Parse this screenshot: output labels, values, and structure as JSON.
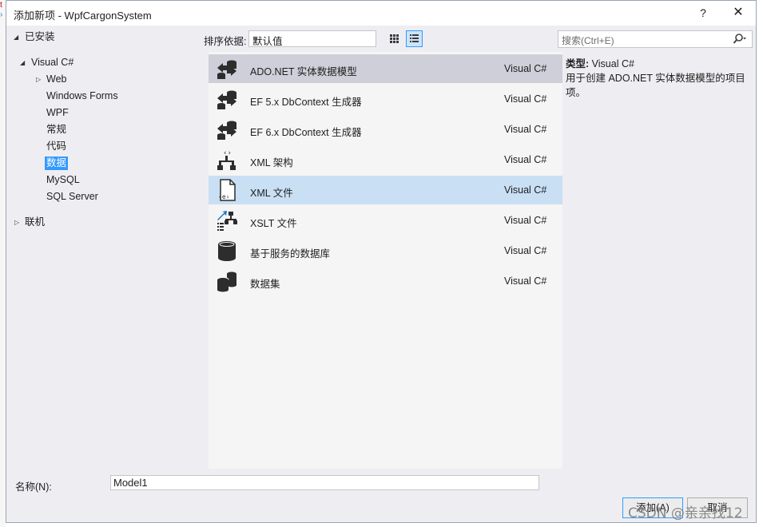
{
  "window": {
    "title": "添加新项 - WpfCargonSystem",
    "help_glyph": "?",
    "close_glyph": "✕"
  },
  "tree": {
    "installed": "已安装",
    "visual_csharp": "Visual C#",
    "children": [
      "Web",
      "Windows Forms",
      "WPF",
      "常规",
      "代码",
      "数据",
      "MySQL",
      "SQL Server"
    ],
    "online": "联机",
    "selected": "数据"
  },
  "toolbar": {
    "sort_label": "排序依据:",
    "sort_value": "默认值"
  },
  "search": {
    "placeholder": "搜索(Ctrl+E)"
  },
  "items": [
    {
      "name": "ADO.NET 实体数据模型",
      "lang": "Visual C#",
      "icon": "entity-model-icon"
    },
    {
      "name": "EF 5.x DbContext 生成器",
      "lang": "Visual C#",
      "icon": "entity-model-icon"
    },
    {
      "name": "EF 6.x DbContext 生成器",
      "lang": "Visual C#",
      "icon": "entity-model-icon"
    },
    {
      "name": "XML 架构",
      "lang": "Visual C#",
      "icon": "xml-schema-icon"
    },
    {
      "name": "XML 文件",
      "lang": "Visual C#",
      "icon": "xml-file-icon"
    },
    {
      "name": "XSLT 文件",
      "lang": "Visual C#",
      "icon": "xslt-file-icon"
    },
    {
      "name": "基于服务的数据库",
      "lang": "Visual C#",
      "icon": "database-icon"
    },
    {
      "name": "数据集",
      "lang": "Visual C#",
      "icon": "dataset-icon"
    }
  ],
  "description": {
    "type_key": "类型:",
    "type_value": "Visual C#",
    "text": "用于创建 ADO.NET 实体数据模型的项目项。"
  },
  "footer": {
    "name_label": "名称(N):",
    "name_value": "Model1",
    "add_label": "添加(A)",
    "cancel_label": "取消"
  },
  "watermark": "CSDN @亲亲找12",
  "colors": {
    "accent": "#3399ff",
    "selected_row": "#cfcfd9",
    "hover_row": "#c9dff4"
  }
}
